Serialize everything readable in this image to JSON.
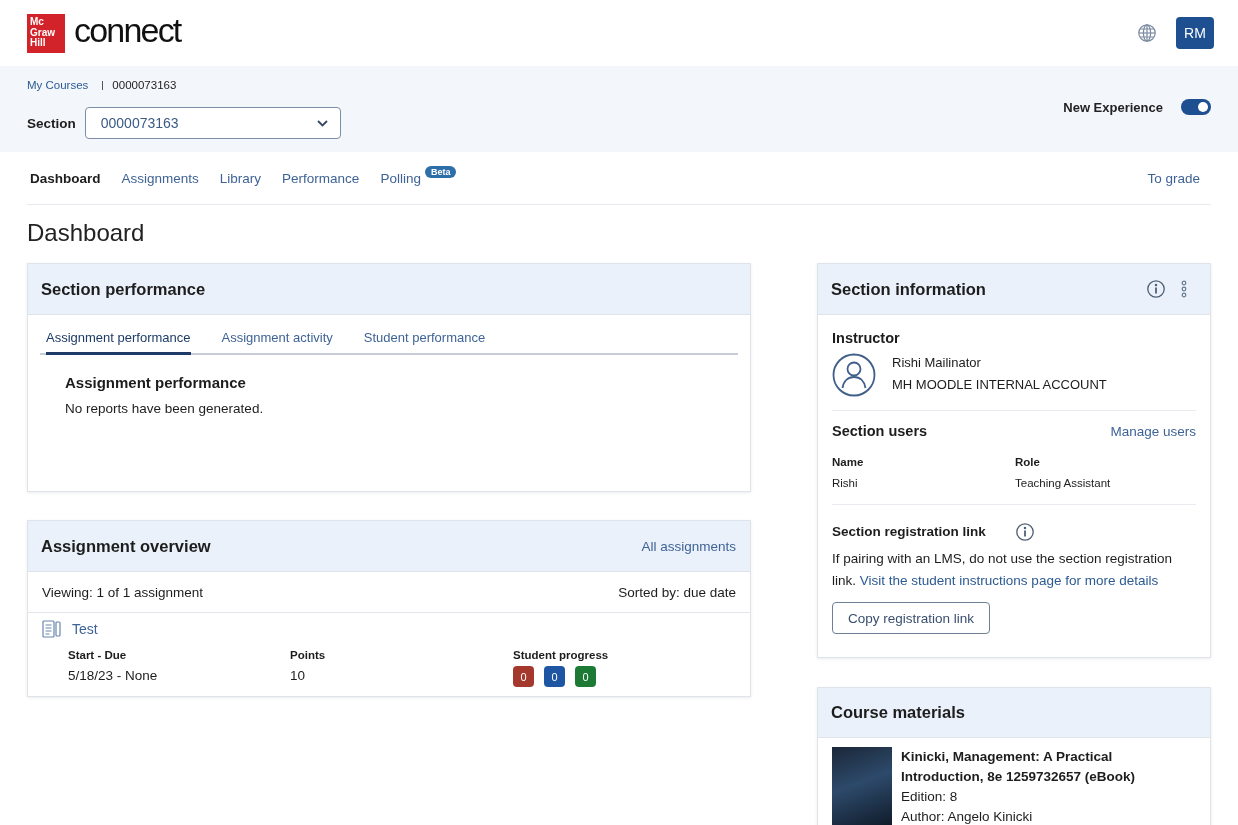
{
  "header": {
    "logo": {
      "mark_lines": [
        "Mc",
        "Graw",
        "Hill"
      ],
      "wordmark": "connect"
    },
    "avatar_initials": "RM"
  },
  "course_bar": {
    "breadcrumb": [
      {
        "label": "My Courses",
        "kind": "link"
      },
      {
        "label": "0000073163",
        "kind": "current"
      }
    ],
    "section_select": {
      "label": "Section",
      "value": "0000073163"
    },
    "toggle": {
      "label": "New Experience",
      "on": true
    }
  },
  "nav": {
    "tabs": [
      {
        "label": "Dashboard",
        "selected": true
      },
      {
        "label": "Assignments",
        "selected": false
      },
      {
        "label": "Library",
        "selected": false
      },
      {
        "label": "Performance",
        "selected": false
      },
      {
        "label": "Polling",
        "selected": false,
        "badge": "Beta"
      }
    ],
    "right_link": "To grade"
  },
  "page_title": "Dashboard",
  "section_performance": {
    "title": "Section performance",
    "tabs": [
      {
        "label": "Assignment performance",
        "selected": true
      },
      {
        "label": "Assignment activity",
        "selected": false
      },
      {
        "label": "Student performance",
        "selected": false
      }
    ],
    "panel_title": "Assignment performance",
    "panel_message": "No reports have been generated."
  },
  "assignment_overview": {
    "title": "Assignment overview",
    "link": "All assignments",
    "viewing": "Viewing: 1 of 1 assignment",
    "sorted": "Sorted by: due date",
    "assignments": [
      {
        "name": "Test",
        "fields": [
          {
            "label": "Start - Due",
            "value": "5/18/23 - None"
          },
          {
            "label": "Points",
            "value": "10"
          }
        ],
        "progress_label": "Student progress",
        "progress": [
          {
            "count": "0",
            "color": "#a4382c"
          },
          {
            "count": "0",
            "color": "#1f56a3"
          },
          {
            "count": "0",
            "color": "#1d7a34"
          }
        ]
      }
    ]
  },
  "section_information": {
    "title": "Section information",
    "instructor": {
      "heading": "Instructor",
      "name": "Rishi Mailinator",
      "account": "MH MOODLE INTERNAL ACCOUNT"
    },
    "users": {
      "heading": "Section users",
      "link": "Manage users",
      "columns": [
        "Name",
        "Role"
      ],
      "rows": [
        [
          "Rishi",
          "Teaching Assistant"
        ]
      ]
    },
    "registration": {
      "heading": "Section registration link",
      "text": "If pairing with an LMS, do not use the section registration link.",
      "link": "Visit the student instructions page for more details",
      "button": "Copy registration link"
    }
  },
  "course_materials": {
    "title": "Course materials",
    "books": [
      {
        "title": "Kinicki, Management: A Practical Introduction, 8e 1259732657 (eBook)",
        "edition": "Edition: 8",
        "author": "Author: Angelo Kinicki"
      }
    ]
  }
}
